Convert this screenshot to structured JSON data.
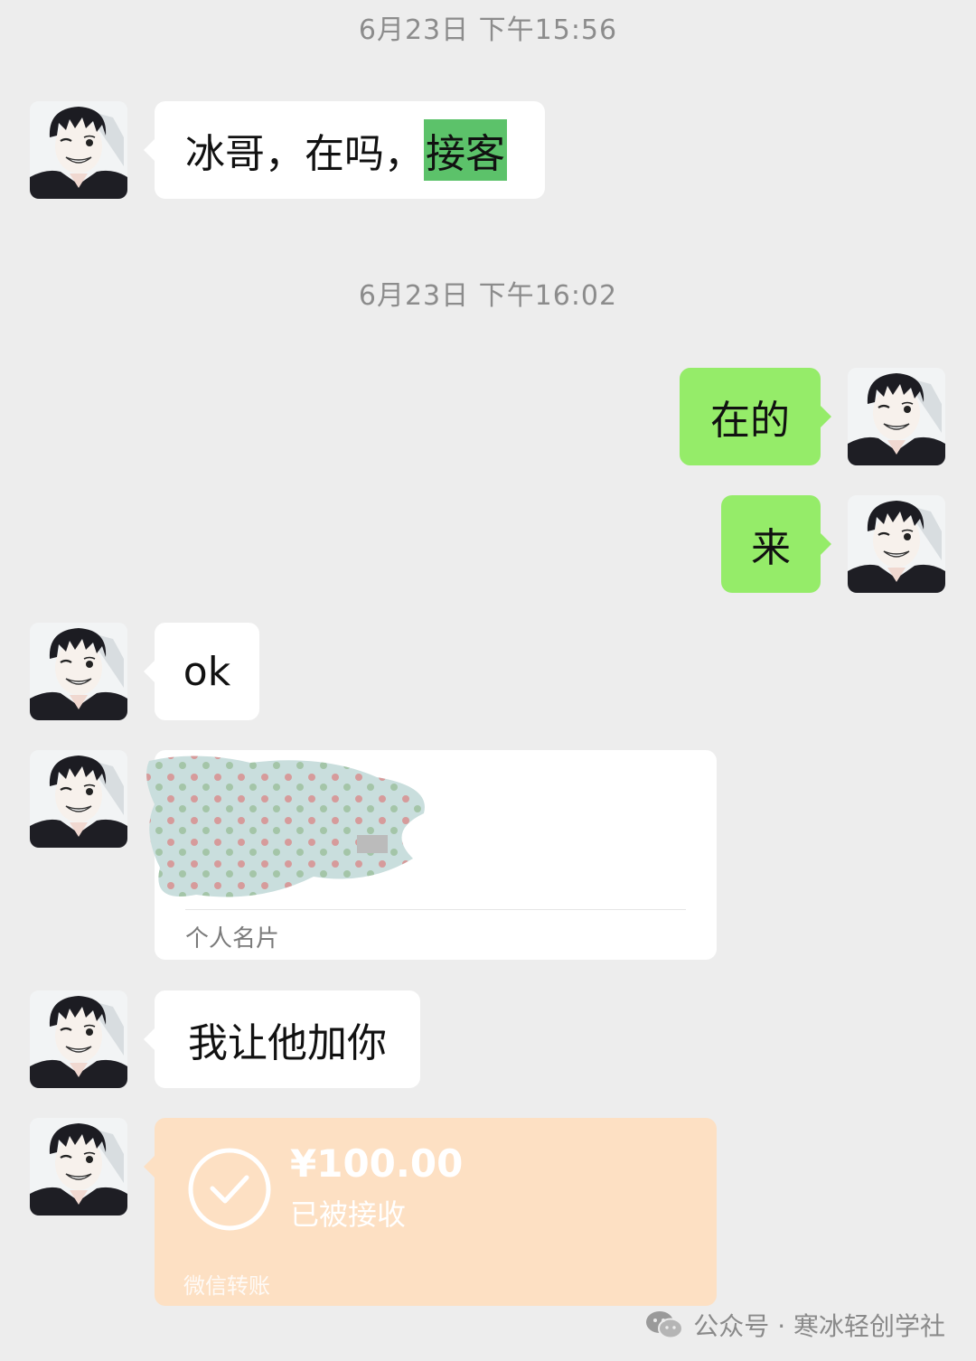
{
  "timestamps": [
    "6月23日 下午15:56",
    "6月23日 下午16:02"
  ],
  "messages": {
    "m1": {
      "prefix": "冰哥，在吗，",
      "highlight": "接客"
    },
    "m2": "在的",
    "m3": "来",
    "m4": "ok",
    "m6": "我让他加你"
  },
  "card": {
    "label": "个人名片"
  },
  "transfer": {
    "amount": "¥100.00",
    "status": "已被接收",
    "source": "微信转账"
  },
  "watermark": "公众号 · 寒冰轻创学社",
  "colors": {
    "background": "#ededed",
    "incoming_bubble": "#ffffff",
    "outgoing_bubble": "#95ec69",
    "highlight": "#5cc26a",
    "transfer_card": "#fde0c3"
  },
  "icons": [
    "avatar",
    "check-circle-icon",
    "wechat-logo-icon"
  ]
}
